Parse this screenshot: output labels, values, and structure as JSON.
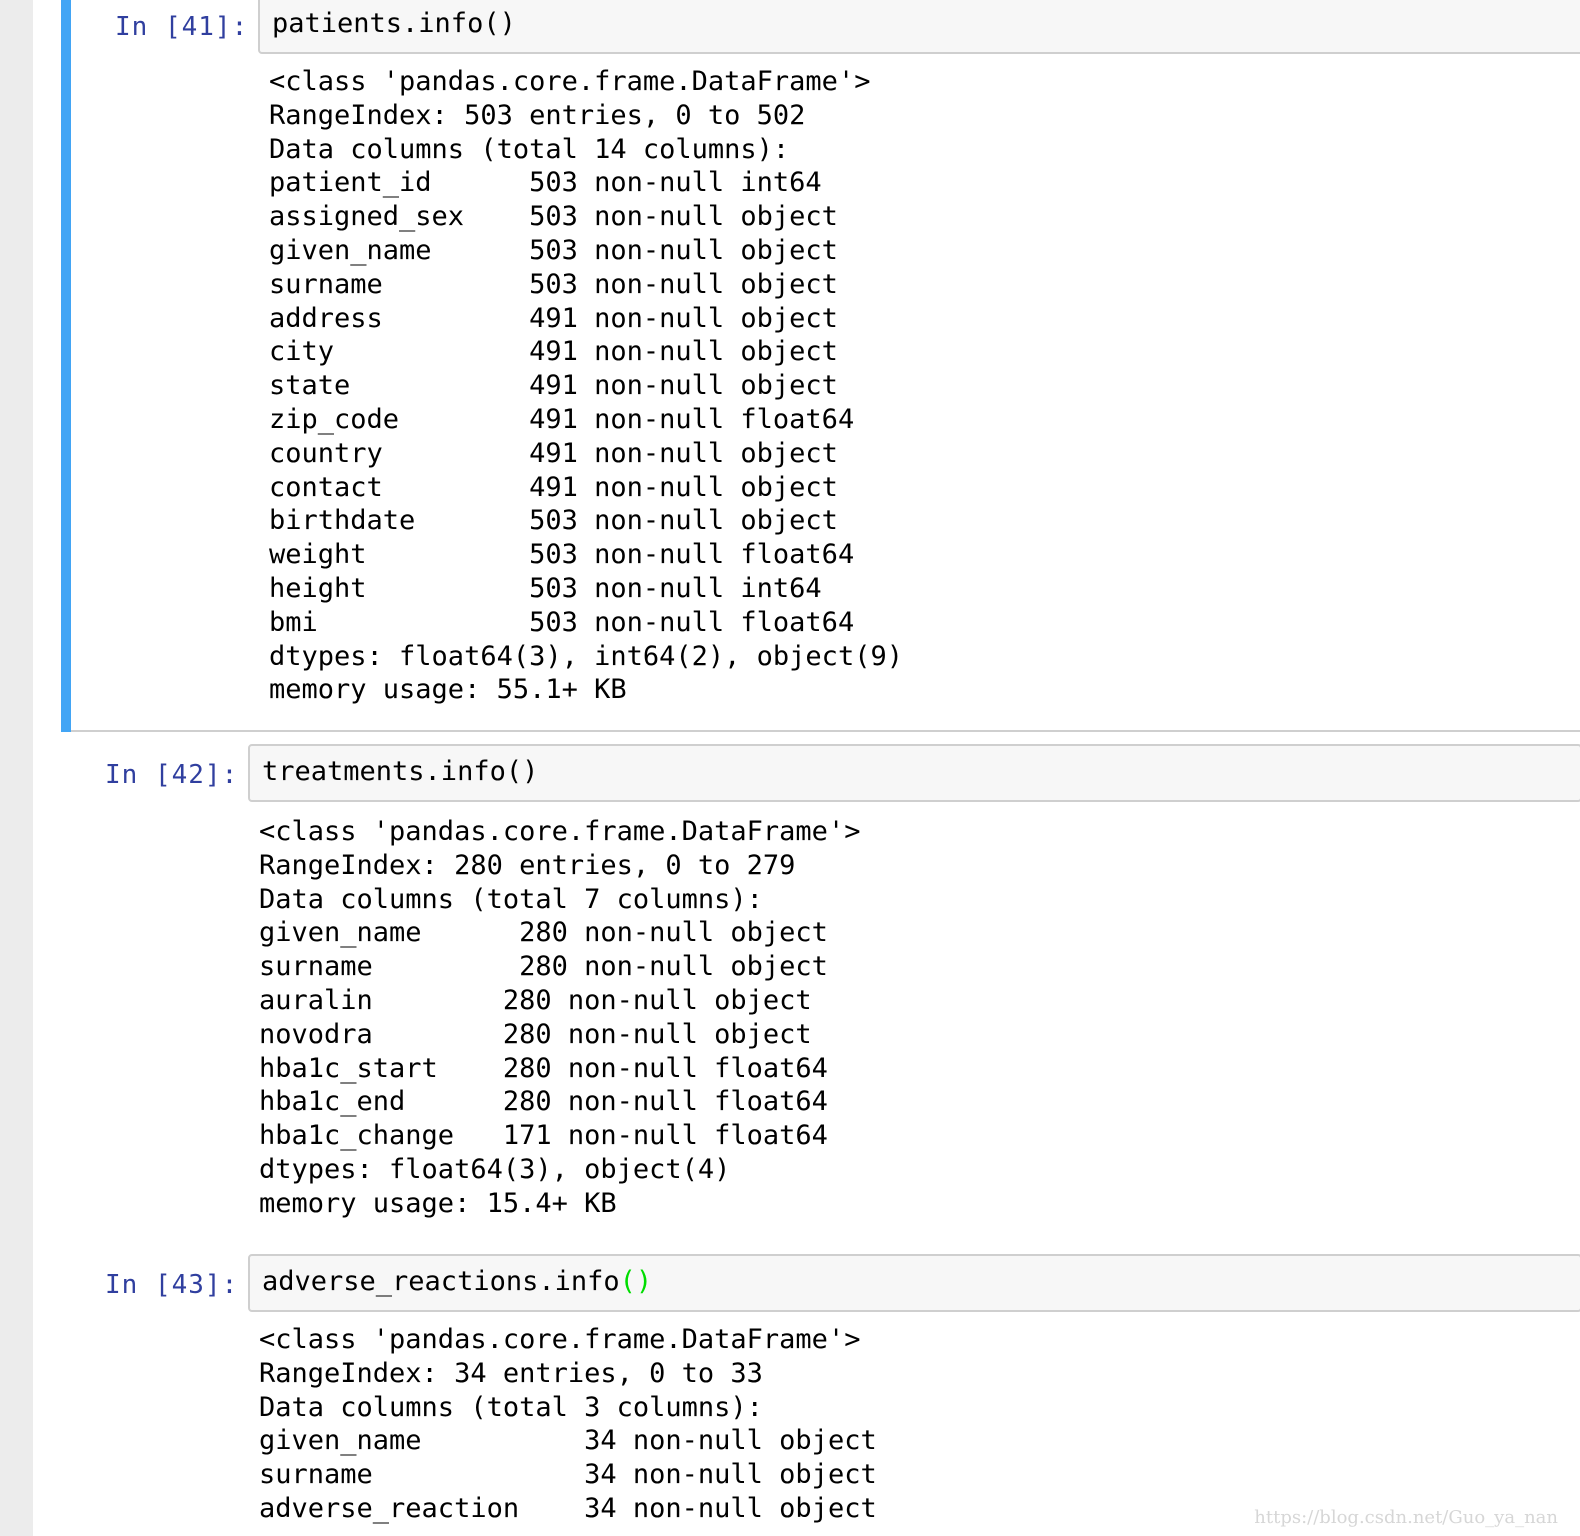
{
  "cells": [
    {
      "prompt": "In [41]:",
      "code": "patients.info()",
      "output": [
        "<class 'pandas.core.frame.DataFrame'>",
        "RangeIndex: 503 entries, 0 to 502",
        "Data columns (total 14 columns):",
        "patient_id      503 non-null int64",
        "assigned_sex    503 non-null object",
        "given_name      503 non-null object",
        "surname         503 non-null object",
        "address         491 non-null object",
        "city            491 non-null object",
        "state           491 non-null object",
        "zip_code        491 non-null float64",
        "country         491 non-null object",
        "contact         491 non-null object",
        "birthdate       503 non-null object",
        "weight          503 non-null float64",
        "height          503 non-null int64",
        "bmi             503 non-null float64",
        "dtypes: float64(3), int64(2), object(9)",
        "memory usage: 55.1+ KB"
      ]
    },
    {
      "prompt": "In [42]:",
      "code": "treatments.info()",
      "output": [
        "<class 'pandas.core.frame.DataFrame'>",
        "RangeIndex: 280 entries, 0 to 279",
        "Data columns (total 7 columns):",
        "given_name      280 non-null object",
        "surname         280 non-null object",
        "auralin        280 non-null object",
        "novodra        280 non-null object",
        "hba1c_start    280 non-null float64",
        "hba1c_end      280 non-null float64",
        "hba1c_change   171 non-null float64",
        "dtypes: float64(3), object(4)",
        "memory usage: 15.4+ KB"
      ]
    },
    {
      "prompt": "In [43]:",
      "code_prefix": "adverse_reactions.info",
      "code_parens": "()",
      "output": [
        "<class 'pandas.core.frame.DataFrame'>",
        "RangeIndex: 34 entries, 0 to 33",
        "Data columns (total 3 columns):",
        "given_name          34 non-null object",
        "surname             34 non-null object",
        "adverse_reaction    34 non-null object"
      ]
    }
  ],
  "watermark": "https://blog.csdn.net/Guo_ya_nan",
  "colors": {
    "prompt": "#303f9f",
    "selected_cell_border": "#42a5f5",
    "matching_paren": "#00dd00",
    "input_background": "#f7f7f7",
    "input_border": "#cfcfcf",
    "page_background": "#ececec",
    "notebook_background": "#ffffff"
  }
}
